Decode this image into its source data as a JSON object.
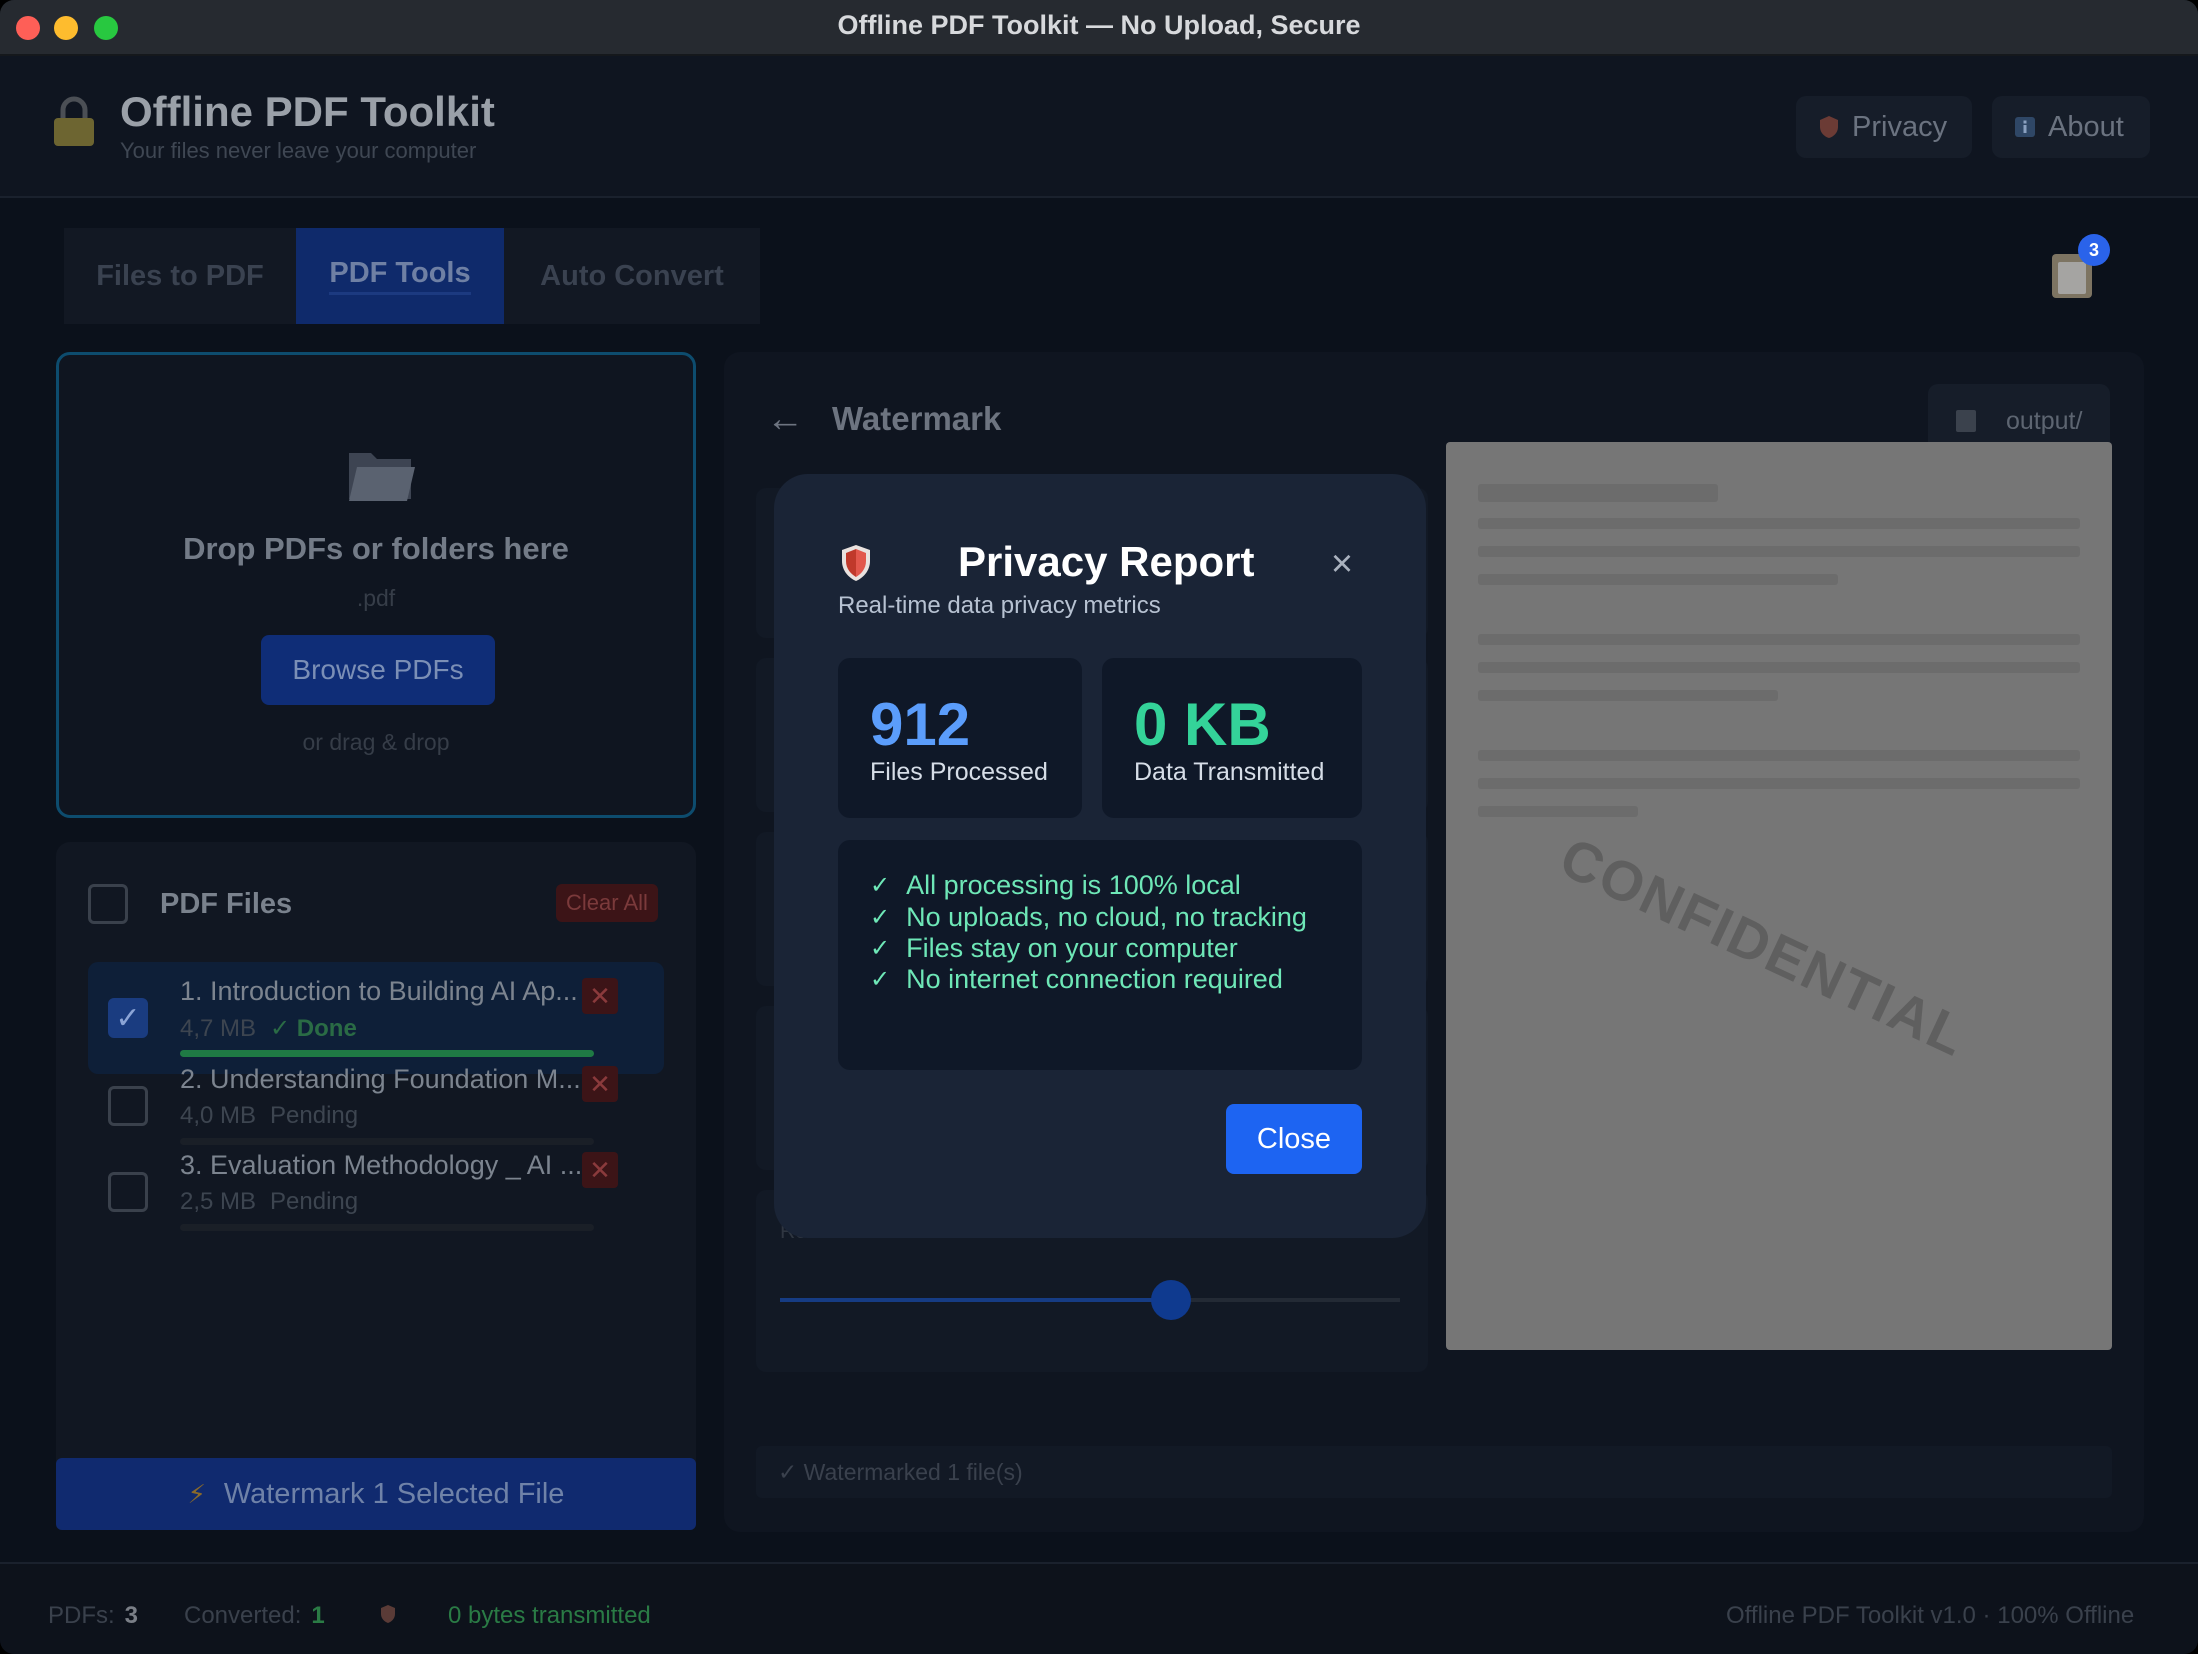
{
  "window": {
    "title": "Offline PDF Toolkit — No Upload, Secure"
  },
  "header": {
    "title": "Offline PDF Toolkit",
    "subtitle": "Your files never leave your computer",
    "privacy_label": "Privacy",
    "about_label": "About",
    "icons": {
      "lock": "lock-icon",
      "privacy": "shield-icon",
      "about": "info-icon"
    }
  },
  "tabs": [
    {
      "label": "Files to PDF",
      "active": false
    },
    {
      "label": "PDF Tools",
      "active": true
    },
    {
      "label": "Auto Convert",
      "active": false
    }
  ],
  "clipboard": {
    "icon": "clipboard-icon",
    "badge": "3"
  },
  "dropzone": {
    "icon": "folder-icon",
    "title": "Drop PDFs or folders here",
    "extension": ".pdf",
    "browse_label": "Browse PDFs",
    "hint": "or drag & drop"
  },
  "files": {
    "title": "PDF Files",
    "clear_label": "Clear All",
    "items": [
      {
        "name": "1. Introduction to Building AI Ap...",
        "size": "4,7 MB",
        "status": "✓ Done",
        "selected": true,
        "progress": 1.0
      },
      {
        "name": "2. Understanding Foundation M...",
        "size": "4,0 MB",
        "status": "Pending",
        "selected": false,
        "progress": 0.0
      },
      {
        "name": "3. Evaluation Methodology _ AI ...",
        "size": "2,5 MB",
        "status": "Pending",
        "selected": false,
        "progress": 0.0
      }
    ]
  },
  "action": {
    "icon": "lightning-icon",
    "label": "Watermark 1 Selected File"
  },
  "tool": {
    "title": "Watermark",
    "output_label": "output/",
    "rotation_label": "Rotation: 25°",
    "rotation_value": 25,
    "rotation_fraction": 0.63,
    "preview_watermark": "CONFIDENTIAL",
    "status": "✓ Watermarked 1 file(s)"
  },
  "statusbar": {
    "pdfs_label": "PDFs:",
    "pdfs_value": "3",
    "converted_label": "Converted:",
    "converted_value": "1",
    "transmitted": "0 bytes transmitted",
    "version": "Offline PDF Toolkit v1.0 · 100% Offline"
  },
  "modal": {
    "title": "Privacy Report",
    "subtitle": "Real-time data privacy metrics",
    "stats": [
      {
        "value": "912",
        "label": "Files Processed"
      },
      {
        "value": "0 KB",
        "label": "Data Transmitted"
      }
    ],
    "checks": [
      "All processing is 100% local",
      "No uploads, no cloud, no tracking",
      "Files stay on your computer",
      "No internet connection required"
    ],
    "close_label": "Close",
    "colors": {
      "accent": "#1d64f2",
      "files_number": "#5b9dfb",
      "data_number": "#34d399",
      "check_text": "#6ee7b7"
    }
  }
}
